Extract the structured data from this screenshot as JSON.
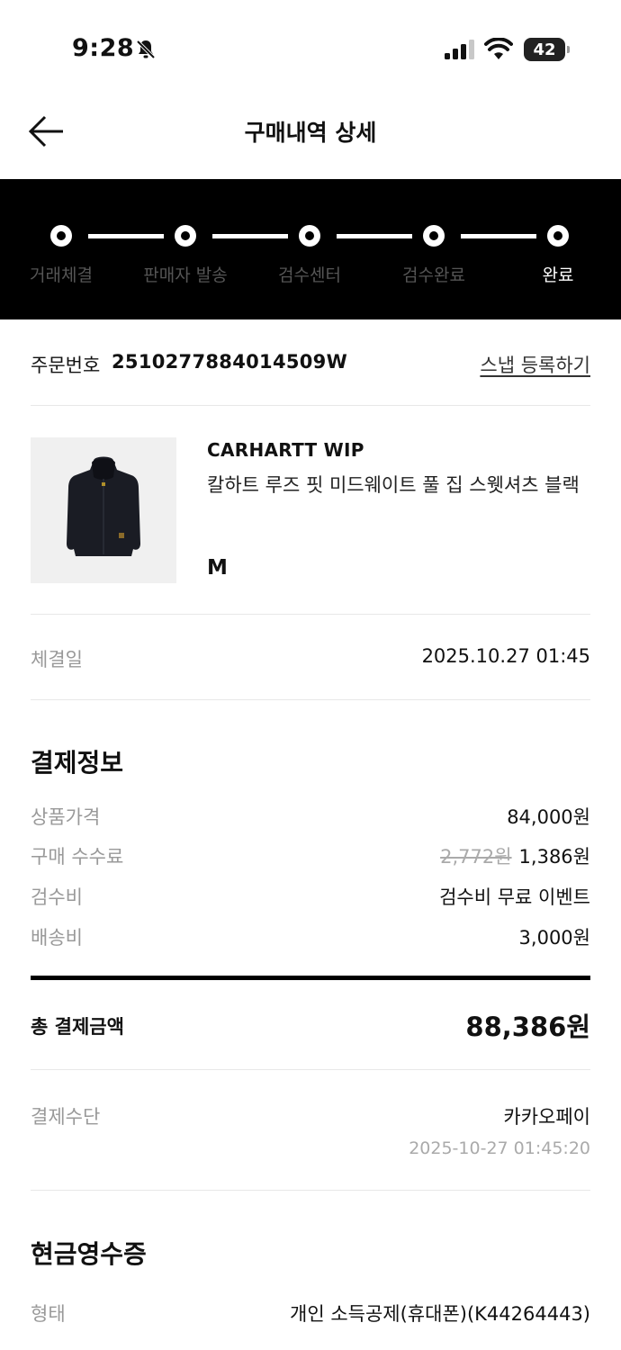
{
  "status_bar": {
    "time": "9:28",
    "battery": "42"
  },
  "header": {
    "title": "구매내역 상세"
  },
  "progress": {
    "steps": [
      "거래체결",
      "판매자 발송",
      "검수센터",
      "검수완료",
      "완료"
    ]
  },
  "order": {
    "label": "주문번호",
    "number": "2510277884014509W",
    "snap_link": "스냅 등록하기"
  },
  "product": {
    "brand": "CARHARTT WIP",
    "name": "칼하트 루즈 핏 미드웨이트 풀 집 스웻셔츠 블랙",
    "size": "M"
  },
  "contract": {
    "label": "체결일",
    "value": "2025.10.27 01:45"
  },
  "payment_info": {
    "title": "결제정보",
    "rows": [
      {
        "label": "상품가격",
        "value": "84,000원"
      },
      {
        "label": "구매 수수료",
        "original": "2,772원",
        "value": "1,386원"
      },
      {
        "label": "검수비",
        "value": "검수비 무료 이벤트"
      },
      {
        "label": "배송비",
        "value": "3,000원"
      }
    ],
    "total_label": "총 결제금액",
    "total_value": "88,386원"
  },
  "payment_method": {
    "label": "결제수단",
    "value": "카카오페이",
    "datetime": "2025-10-27 01:45:20"
  },
  "cash_receipt": {
    "title": "현금영수증",
    "type_label": "형태",
    "type_value": "개인 소득공제(휴대폰)(K44264443)"
  }
}
